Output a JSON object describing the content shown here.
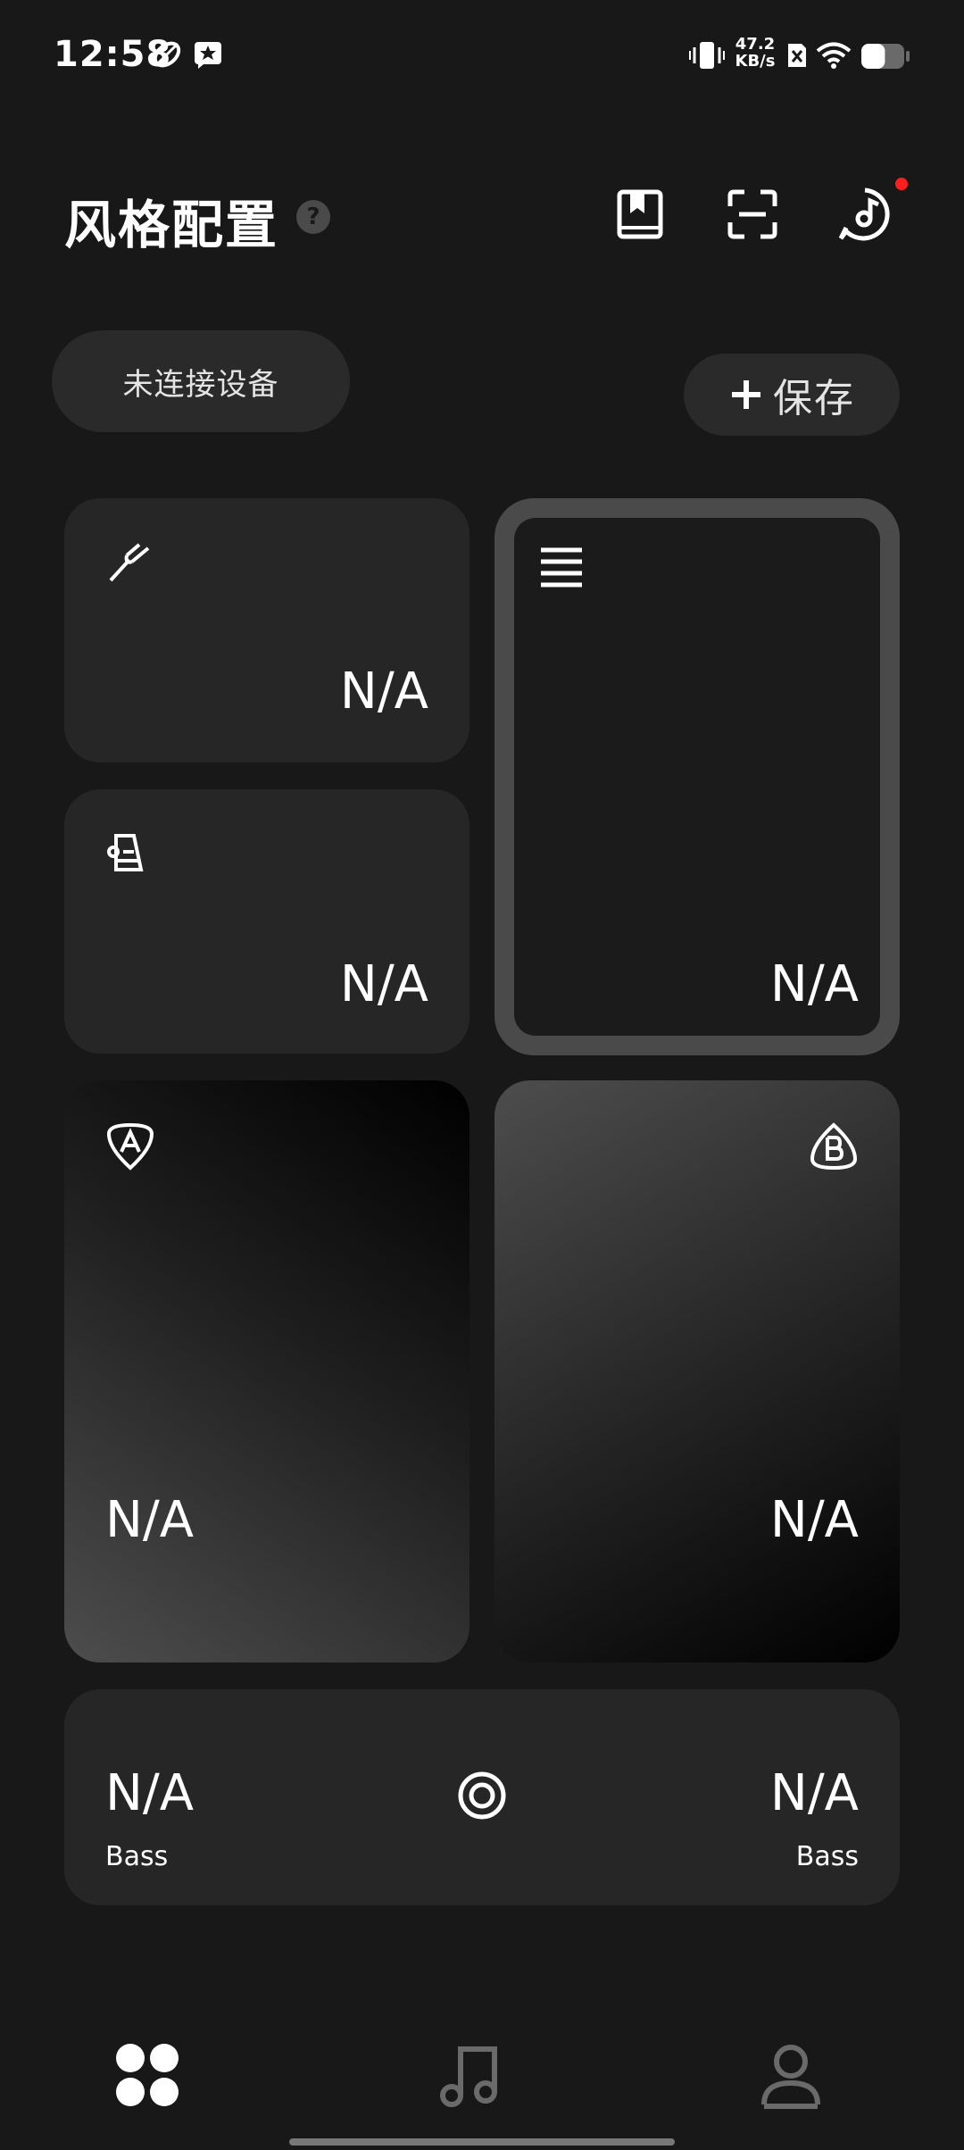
{
  "status_bar": {
    "time": "12:58",
    "net_speed_value": "47.2",
    "net_speed_unit": "KB/s",
    "battery_level": 0.55,
    "icons": [
      "leaf-icon",
      "star-message-icon",
      "vibrate-icon",
      "sim-off-icon",
      "wifi-icon",
      "battery-icon"
    ]
  },
  "header": {
    "title": "风格配置",
    "help_label": "?",
    "actions": [
      "book-icon",
      "scan-icon",
      "music-disc-icon"
    ],
    "has_notification": true
  },
  "device": {
    "status_label": "未连接设备"
  },
  "save": {
    "label": "保存",
    "icon": "plus-icon"
  },
  "cards": {
    "tuning": {
      "icon": "tuning-fork-icon",
      "value": "N/A"
    },
    "preset": {
      "icon": "device-preset-icon",
      "value": "N/A"
    },
    "list": {
      "icon": "list-icon",
      "value": "N/A"
    },
    "slot_a": {
      "icon": "pick-a-icon",
      "value": "N/A"
    },
    "slot_b": {
      "icon": "pick-b-icon",
      "value": "N/A"
    },
    "bass": {
      "left_value": "N/A",
      "left_label": "Bass",
      "right_value": "N/A",
      "right_label": "Bass",
      "center_icon": "target-icon"
    }
  },
  "nav": {
    "items": [
      "home-grid-icon",
      "music-note-icon",
      "profile-icon"
    ],
    "active_index": 0
  },
  "colors": {
    "background": "#181818",
    "card": "#262626",
    "pill": "#2a2a2a",
    "accent_border": "#4a4a4a",
    "notification": "#ff1e1e"
  }
}
